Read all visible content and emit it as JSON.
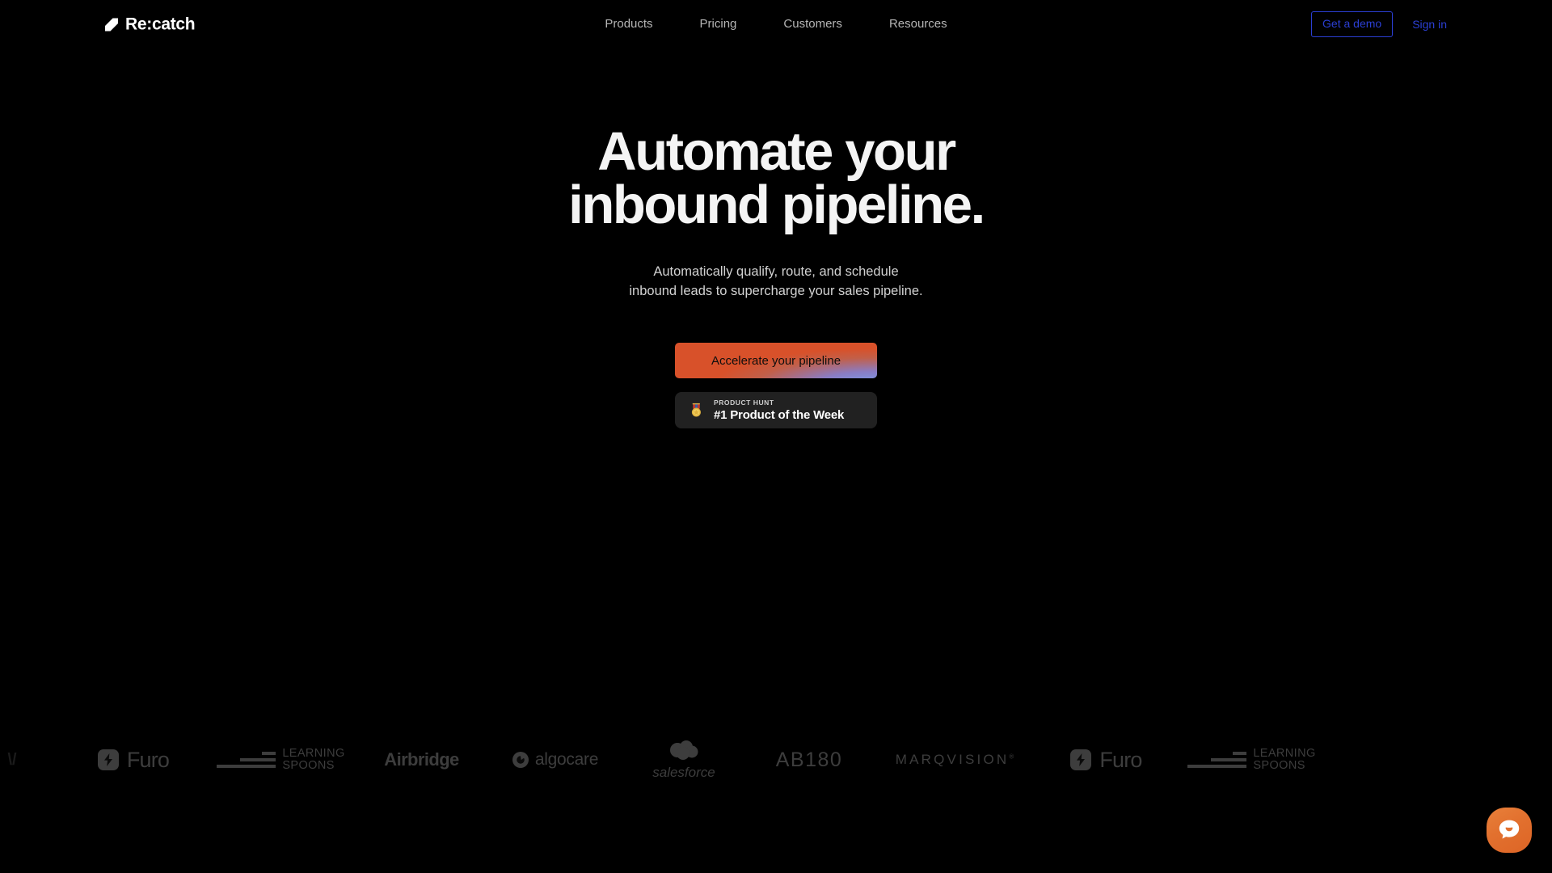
{
  "brand": {
    "name": "Re:catch",
    "mark_icon": "recatch-arrow-mark-icon"
  },
  "nav": {
    "links": [
      {
        "label": "Products"
      },
      {
        "label": "Pricing"
      },
      {
        "label": "Customers"
      },
      {
        "label": "Resources"
      }
    ],
    "demo_button": "Get a demo",
    "signin_link": "Sign in",
    "accent_blue": "#2b3fd4"
  },
  "hero": {
    "title": "Automate your\ninbound pipeline.",
    "subtitle": "Automatically qualify, route, and schedule\ninbound leads to supercharge your sales pipeline.",
    "cta_label": "Accelerate your pipeline",
    "cta_color_start": "#d8512a",
    "cta_color_end": "#7e93e0",
    "badge": {
      "icon": "medal-icon",
      "eyebrow": "PRODUCT HUNT",
      "title": "#1 Product of the Week",
      "background": "#212121"
    },
    "title_color": "#f4f4f4",
    "subtitle_color": "#d2d2d2"
  },
  "logos": {
    "color": "#3d3d3d",
    "items": [
      {
        "id": "edge-partial",
        "name": ""
      },
      {
        "id": "furo",
        "name": "Furo",
        "icon": "lightning-bolt-icon"
      },
      {
        "id": "learning-spoons",
        "line1": "LEARNING",
        "line2": "SPOONS",
        "icon": "stacked-bars-icon"
      },
      {
        "id": "airbridge",
        "name": "Airbridge"
      },
      {
        "id": "algocare",
        "name": "algocare",
        "icon": "algocare-circle-icon"
      },
      {
        "id": "salesforce",
        "name": "salesforce",
        "icon": "cloud-icon"
      },
      {
        "id": "ab180",
        "name": "AB180"
      },
      {
        "id": "marqvision",
        "name": "MARQVISION",
        "mark": "®"
      },
      {
        "id": "furo-2",
        "name": "Furo",
        "icon": "lightning-bolt-icon"
      },
      {
        "id": "learning-spoons-2",
        "line1": "LEARNING",
        "line2": "SPOONS",
        "icon": "stacked-bars-icon"
      }
    ]
  },
  "chat": {
    "icon": "chat-bubble-smile-icon",
    "color": "#e2702e"
  }
}
